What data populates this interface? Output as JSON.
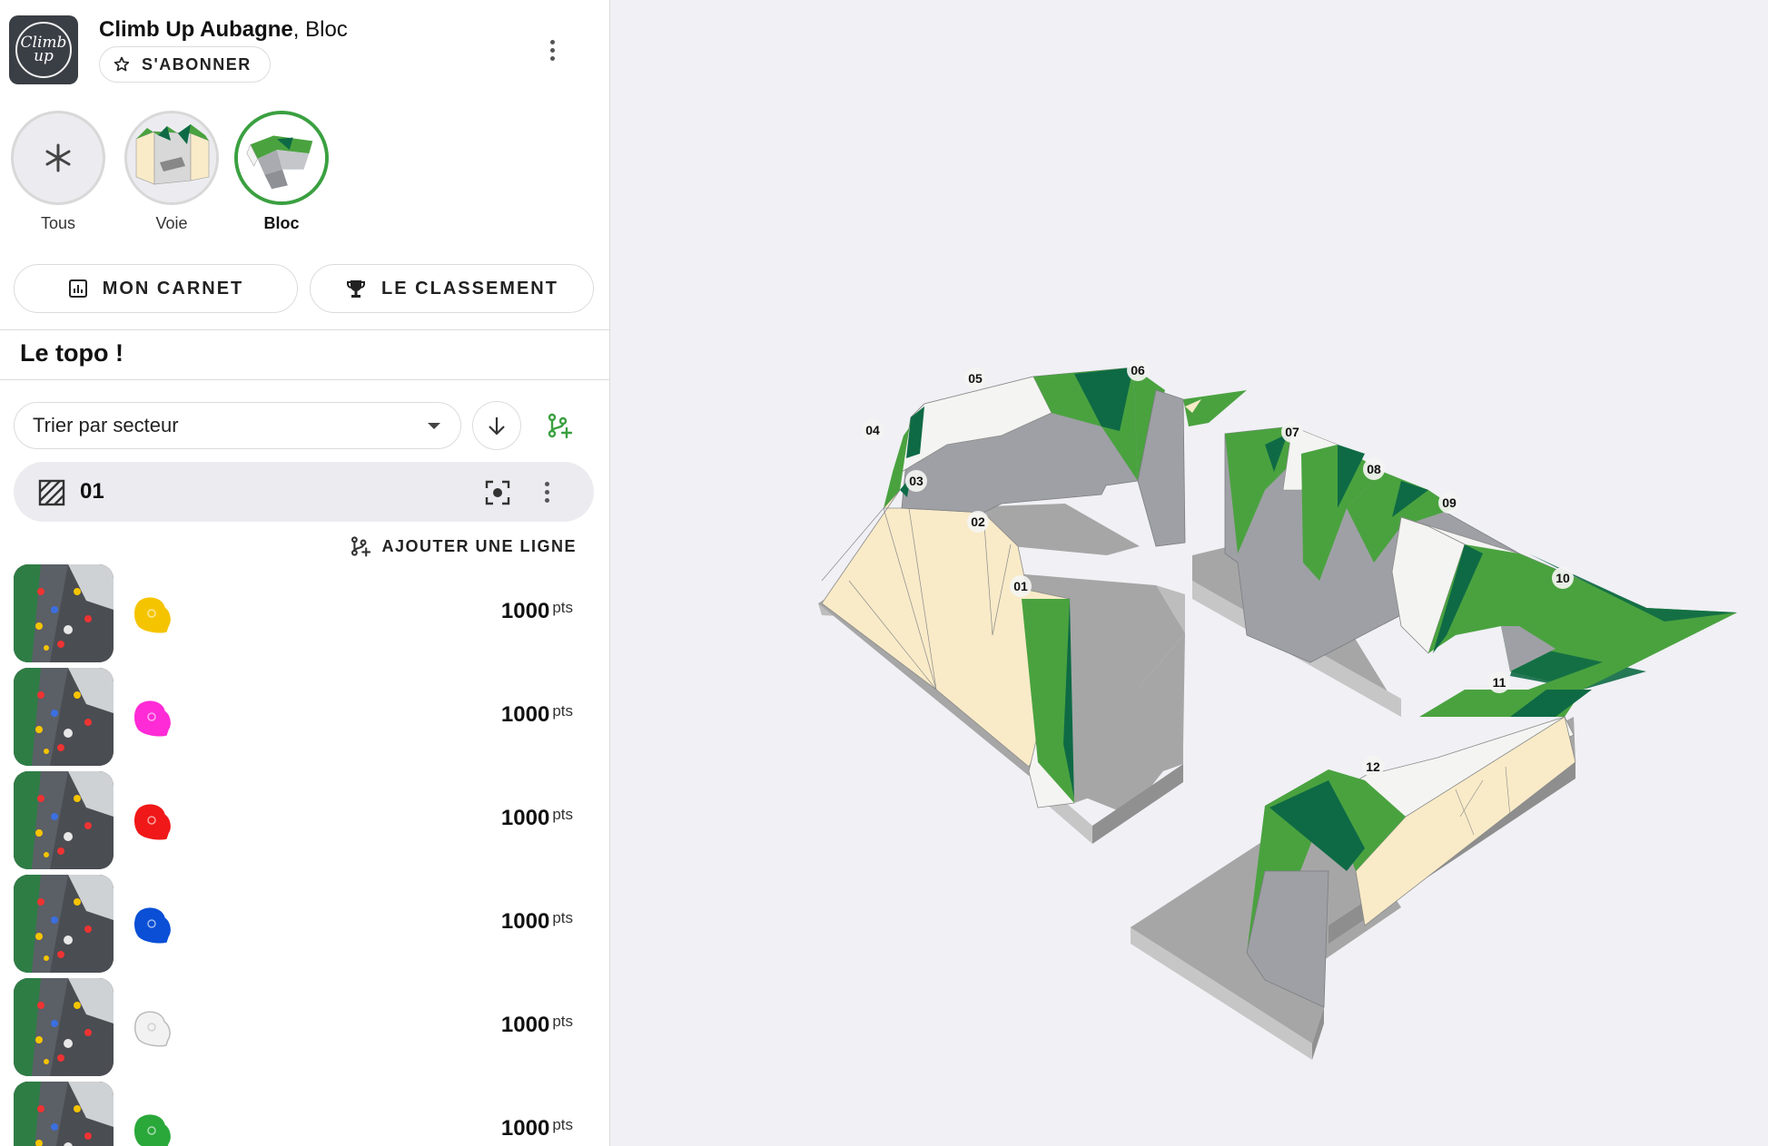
{
  "header": {
    "gym_name": "Climb Up Aubagne",
    "gym_suffix": ", Bloc",
    "logo_text_1": "Climb",
    "logo_text_2": "up",
    "subscribe_label": "S'ABONNER"
  },
  "categories": [
    {
      "label": "Tous",
      "icon": "asterisk-icon",
      "active": false
    },
    {
      "label": "Voie",
      "icon": "wall-thumbnail",
      "active": false
    },
    {
      "label": "Bloc",
      "icon": "boulder-thumbnail",
      "active": true
    }
  ],
  "actions": {
    "logbook_label": "MON CARNET",
    "ranking_label": "LE CLASSEMENT"
  },
  "topo": {
    "title": "Le topo !",
    "sort_value": "Trier par secteur",
    "sector_name": "01",
    "add_line_label": "AJOUTER UNE LIGNE"
  },
  "routes": [
    {
      "hold_color": "#f5c400",
      "points": "1000",
      "unit": "pts"
    },
    {
      "hold_color": "#ff2bd6",
      "points": "1000",
      "unit": "pts"
    },
    {
      "hold_color": "#f01818",
      "points": "1000",
      "unit": "pts"
    },
    {
      "hold_color": "#0a4fd6",
      "points": "1000",
      "unit": "pts"
    },
    {
      "hold_color": "#f2f2f2",
      "points": "1000",
      "unit": "pts"
    },
    {
      "hold_color": "#2aa83a",
      "points": "1000",
      "unit": "pts"
    }
  ],
  "map": {
    "sector_labels": [
      "01",
      "02",
      "03",
      "04",
      "05",
      "06",
      "07",
      "08",
      "09",
      "10",
      "11",
      "12"
    ]
  },
  "colors": {
    "accent_green": "#3aa040",
    "wall_green": "#4aa23f",
    "wall_dark_green": "#0e6a45",
    "wall_beige": "#f9ebc8",
    "wall_white": "#f4f4f2",
    "wall_grey": "#9a9ca1",
    "floor_grey": "#a8a8a8"
  }
}
